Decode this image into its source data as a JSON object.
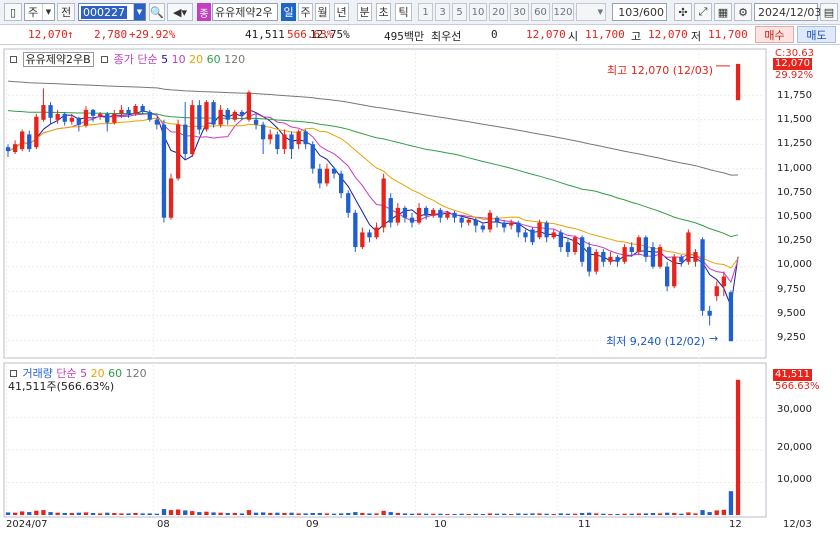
{
  "toolbar": {
    "market": "주",
    "scope": "전",
    "code": "000227",
    "name": "유유제약2우",
    "period_buttons": [
      "일",
      "주",
      "월",
      "년",
      "분",
      "초",
      "틱"
    ],
    "active_period": "일",
    "number_buttons": [
      "1",
      "3",
      "5",
      "10",
      "20",
      "30",
      "60",
      "120"
    ],
    "count": "103/600",
    "date": "2024/12/03"
  },
  "info": {
    "price": "12,070",
    "change": "2,780",
    "change_pct": "+29.92%",
    "volume": "41,511",
    "volume_pct": "566.63%",
    "turnover": "12.75%",
    "amount": "495백만",
    "priority_label": "최우선",
    "priority_value": "0",
    "close": "12,070",
    "open_label": "시",
    "open": "11,700",
    "high_label": "고",
    "high": "12,070",
    "low_label": "저",
    "low": "11,700",
    "buy_label": "매수",
    "sell_label": "매도"
  },
  "price_panel": {
    "name": "유유제약2우B",
    "legend_label": "종가 단순",
    "ma_periods": [
      "5",
      "10",
      "20",
      "60",
      "120"
    ],
    "max_note": "최고 12,070 (12/03)",
    "min_note": "최저 9,240 (12/02)",
    "tag_top": "C:30.63",
    "tag_price": "12,070",
    "tag_pct": "29.92%",
    "y_ticks": [
      "11,750",
      "11,500",
      "11,250",
      "11,000",
      "10,750",
      "10,500",
      "10,250",
      "10,000",
      "9,750",
      "9,500",
      "9,250"
    ]
  },
  "volume_panel": {
    "legend_label": "거래량",
    "ma_label": "단순",
    "ma_periods": [
      "5",
      "20",
      "60",
      "120"
    ],
    "current": "41,511주(566.63%)",
    "tag_value": "41,511",
    "tag_pct": "566.63%",
    "y_ticks": [
      "30,000",
      "20,000",
      "10,000"
    ]
  },
  "x_labels": [
    "2024/07",
    "08",
    "09",
    "10",
    "11",
    "12",
    "12/03"
  ],
  "colors": {
    "up": "#e8231b",
    "down": "#1f5fd0",
    "ma5": "#1a1aa0",
    "ma10": "#c23fc2",
    "ma20": "#e8a400",
    "ma60": "#2f9e4a",
    "ma120": "#777777"
  },
  "chart_data": {
    "type": "candlestick",
    "price_range": [
      9150,
      12120
    ],
    "volume_range": [
      0,
      43000
    ],
    "candles": [
      {
        "o": 11220,
        "c": 11180,
        "h": 11250,
        "l": 11120,
        "v": 800
      },
      {
        "o": 11170,
        "c": 11250,
        "h": 11290,
        "l": 11150,
        "v": 700
      },
      {
        "o": 11200,
        "c": 11380,
        "h": 11400,
        "l": 11180,
        "v": 1100
      },
      {
        "o": 11350,
        "c": 11200,
        "h": 11390,
        "l": 11170,
        "v": 900
      },
      {
        "o": 11220,
        "c": 11530,
        "h": 11560,
        "l": 11200,
        "v": 1300
      },
      {
        "o": 11500,
        "c": 11650,
        "h": 11820,
        "l": 11480,
        "v": 1500
      },
      {
        "o": 11650,
        "c": 11520,
        "h": 11680,
        "l": 11450,
        "v": 900
      },
      {
        "o": 11500,
        "c": 11560,
        "h": 11600,
        "l": 11460,
        "v": 700
      },
      {
        "o": 11560,
        "c": 11480,
        "h": 11580,
        "l": 11440,
        "v": 600
      },
      {
        "o": 11480,
        "c": 11520,
        "h": 11560,
        "l": 11450,
        "v": 600
      },
      {
        "o": 11520,
        "c": 11450,
        "h": 11530,
        "l": 11380,
        "v": 700
      },
      {
        "o": 11440,
        "c": 11600,
        "h": 11640,
        "l": 11420,
        "v": 800
      },
      {
        "o": 11600,
        "c": 11540,
        "h": 11610,
        "l": 11480,
        "v": 600
      },
      {
        "o": 11540,
        "c": 11560,
        "h": 11580,
        "l": 11500,
        "v": 500
      },
      {
        "o": 11560,
        "c": 11470,
        "h": 11580,
        "l": 11380,
        "v": 700
      },
      {
        "o": 11470,
        "c": 11560,
        "h": 11600,
        "l": 11450,
        "v": 600
      },
      {
        "o": 11560,
        "c": 11600,
        "h": 11650,
        "l": 11520,
        "v": 500
      },
      {
        "o": 11600,
        "c": 11560,
        "h": 11630,
        "l": 11520,
        "v": 500
      },
      {
        "o": 11560,
        "c": 11640,
        "h": 11660,
        "l": 11540,
        "v": 600
      },
      {
        "o": 11640,
        "c": 11580,
        "h": 11660,
        "l": 11560,
        "v": 500
      },
      {
        "o": 11580,
        "c": 11500,
        "h": 11600,
        "l": 11480,
        "v": 500
      },
      {
        "o": 11500,
        "c": 11450,
        "h": 11520,
        "l": 11400,
        "v": 400
      },
      {
        "o": 11450,
        "c": 10500,
        "h": 11500,
        "l": 10450,
        "v": 1800
      },
      {
        "o": 10500,
        "c": 10900,
        "h": 10950,
        "l": 10480,
        "v": 1500
      },
      {
        "o": 10900,
        "c": 11450,
        "h": 11500,
        "l": 10880,
        "v": 1700
      },
      {
        "o": 11450,
        "c": 11150,
        "h": 11680,
        "l": 11100,
        "v": 1400
      },
      {
        "o": 11150,
        "c": 11650,
        "h": 11700,
        "l": 11120,
        "v": 1200
      },
      {
        "o": 11650,
        "c": 11400,
        "h": 11700,
        "l": 11350,
        "v": 900
      },
      {
        "o": 11400,
        "c": 11680,
        "h": 11700,
        "l": 11380,
        "v": 1000
      },
      {
        "o": 11680,
        "c": 11450,
        "h": 11700,
        "l": 11420,
        "v": 800
      },
      {
        "o": 11450,
        "c": 11600,
        "h": 11650,
        "l": 11420,
        "v": 700
      },
      {
        "o": 11600,
        "c": 11500,
        "h": 11620,
        "l": 11450,
        "v": 600
      },
      {
        "o": 11500,
        "c": 11580,
        "h": 11600,
        "l": 11480,
        "v": 600
      },
      {
        "o": 11580,
        "c": 11550,
        "h": 11600,
        "l": 11500,
        "v": 500
      },
      {
        "o": 11500,
        "c": 11780,
        "h": 11800,
        "l": 11480,
        "v": 1500
      },
      {
        "o": 11500,
        "c": 11450,
        "h": 11560,
        "l": 11400,
        "v": 700
      },
      {
        "o": 11450,
        "c": 11300,
        "h": 11480,
        "l": 11150,
        "v": 800
      },
      {
        "o": 11300,
        "c": 11350,
        "h": 11400,
        "l": 11250,
        "v": 600
      },
      {
        "o": 11350,
        "c": 11200,
        "h": 11380,
        "l": 11150,
        "v": 700
      },
      {
        "o": 11200,
        "c": 11350,
        "h": 11400,
        "l": 11150,
        "v": 600
      },
      {
        "o": 11350,
        "c": 11200,
        "h": 11380,
        "l": 11100,
        "v": 700
      },
      {
        "o": 11250,
        "c": 11380,
        "h": 11400,
        "l": 11200,
        "v": 500
      },
      {
        "o": 11380,
        "c": 11250,
        "h": 11400,
        "l": 11200,
        "v": 500
      },
      {
        "o": 11250,
        "c": 11000,
        "h": 11280,
        "l": 10950,
        "v": 600
      },
      {
        "o": 11000,
        "c": 10850,
        "h": 11050,
        "l": 10800,
        "v": 600
      },
      {
        "o": 10850,
        "c": 11000,
        "h": 11050,
        "l": 10820,
        "v": 500
      },
      {
        "o": 11000,
        "c": 10950,
        "h": 11020,
        "l": 10900,
        "v": 400
      },
      {
        "o": 10950,
        "c": 10750,
        "h": 10980,
        "l": 10700,
        "v": 500
      },
      {
        "o": 10750,
        "c": 10550,
        "h": 10780,
        "l": 10500,
        "v": 600
      },
      {
        "o": 10550,
        "c": 10200,
        "h": 10580,
        "l": 10150,
        "v": 900
      },
      {
        "o": 10200,
        "c": 10350,
        "h": 10400,
        "l": 10180,
        "v": 600
      },
      {
        "o": 10350,
        "c": 10300,
        "h": 10380,
        "l": 10250,
        "v": 500
      },
      {
        "o": 10300,
        "c": 10400,
        "h": 10450,
        "l": 10280,
        "v": 500
      },
      {
        "o": 10400,
        "c": 10900,
        "h": 10950,
        "l": 10350,
        "v": 1300
      },
      {
        "o": 10700,
        "c": 10450,
        "h": 10750,
        "l": 10400,
        "v": 900
      },
      {
        "o": 10450,
        "c": 10600,
        "h": 10650,
        "l": 10420,
        "v": 600
      },
      {
        "o": 10600,
        "c": 10500,
        "h": 10620,
        "l": 10450,
        "v": 500
      },
      {
        "o": 10500,
        "c": 10450,
        "h": 10550,
        "l": 10400,
        "v": 400
      },
      {
        "o": 10450,
        "c": 10600,
        "h": 10650,
        "l": 10430,
        "v": 500
      },
      {
        "o": 10600,
        "c": 10520,
        "h": 10620,
        "l": 10480,
        "v": 400
      },
      {
        "o": 10520,
        "c": 10580,
        "h": 10600,
        "l": 10500,
        "v": 400
      },
      {
        "o": 10580,
        "c": 10500,
        "h": 10600,
        "l": 10450,
        "v": 400
      },
      {
        "o": 10500,
        "c": 10550,
        "h": 10570,
        "l": 10480,
        "v": 300
      },
      {
        "o": 10550,
        "c": 10500,
        "h": 10570,
        "l": 10450,
        "v": 300
      },
      {
        "o": 10500,
        "c": 10450,
        "h": 10520,
        "l": 10400,
        "v": 400
      },
      {
        "o": 10450,
        "c": 10480,
        "h": 10500,
        "l": 10420,
        "v": 300
      },
      {
        "o": 10480,
        "c": 10420,
        "h": 10500,
        "l": 10350,
        "v": 400
      },
      {
        "o": 10420,
        "c": 10380,
        "h": 10450,
        "l": 10350,
        "v": 300
      },
      {
        "o": 10380,
        "c": 10550,
        "h": 10580,
        "l": 10350,
        "v": 500
      },
      {
        "o": 10500,
        "c": 10450,
        "h": 10520,
        "l": 10400,
        "v": 400
      },
      {
        "o": 10450,
        "c": 10400,
        "h": 10480,
        "l": 10350,
        "v": 400
      },
      {
        "o": 10420,
        "c": 10450,
        "h": 10480,
        "l": 10380,
        "v": 300
      },
      {
        "o": 10450,
        "c": 10350,
        "h": 10470,
        "l": 10300,
        "v": 500
      },
      {
        "o": 10350,
        "c": 10300,
        "h": 10380,
        "l": 10250,
        "v": 400
      },
      {
        "o": 10380,
        "c": 10250,
        "h": 10400,
        "l": 10220,
        "v": 500
      },
      {
        "o": 10300,
        "c": 10450,
        "h": 10480,
        "l": 10280,
        "v": 500
      },
      {
        "o": 10450,
        "c": 10300,
        "h": 10470,
        "l": 10250,
        "v": 400
      },
      {
        "o": 10300,
        "c": 10350,
        "h": 10380,
        "l": 10280,
        "v": 300
      },
      {
        "o": 10350,
        "c": 10200,
        "h": 10380,
        "l": 10150,
        "v": 500
      },
      {
        "o": 10250,
        "c": 10150,
        "h": 10280,
        "l": 10100,
        "v": 400
      },
      {
        "o": 10150,
        "c": 10300,
        "h": 10320,
        "l": 10120,
        "v": 400
      },
      {
        "o": 10300,
        "c": 10050,
        "h": 10320,
        "l": 10000,
        "v": 600
      },
      {
        "o": 10200,
        "c": 9950,
        "h": 10250,
        "l": 9900,
        "v": 700
      },
      {
        "o": 9950,
        "c": 10150,
        "h": 10180,
        "l": 9920,
        "v": 500
      },
      {
        "o": 10150,
        "c": 10050,
        "h": 10180,
        "l": 10000,
        "v": 400
      },
      {
        "o": 10050,
        "c": 10100,
        "h": 10150,
        "l": 10020,
        "v": 300
      },
      {
        "o": 10100,
        "c": 10050,
        "h": 10120,
        "l": 10000,
        "v": 300
      },
      {
        "o": 10050,
        "c": 10200,
        "h": 10230,
        "l": 10030,
        "v": 400
      },
      {
        "o": 10200,
        "c": 10150,
        "h": 10250,
        "l": 10100,
        "v": 400
      },
      {
        "o": 10150,
        "c": 10300,
        "h": 10320,
        "l": 10120,
        "v": 500
      },
      {
        "o": 10300,
        "c": 10100,
        "h": 10320,
        "l": 10050,
        "v": 500
      },
      {
        "o": 10200,
        "c": 10000,
        "h": 10250,
        "l": 9980,
        "v": 600
      },
      {
        "o": 10000,
        "c": 10200,
        "h": 10230,
        "l": 9980,
        "v": 500
      },
      {
        "o": 10000,
        "c": 9800,
        "h": 10050,
        "l": 9750,
        "v": 700
      },
      {
        "o": 9800,
        "c": 10100,
        "h": 10130,
        "l": 9780,
        "v": 600
      },
      {
        "o": 10100,
        "c": 10050,
        "h": 10120,
        "l": 10000,
        "v": 400
      },
      {
        "o": 10050,
        "c": 10350,
        "h": 10380,
        "l": 10020,
        "v": 800
      },
      {
        "o": 10050,
        "c": 10150,
        "h": 10180,
        "l": 10000,
        "v": 500
      },
      {
        "o": 10280,
        "c": 9550,
        "h": 10300,
        "l": 9500,
        "v": 1500
      },
      {
        "o": 9550,
        "c": 9500,
        "h": 9600,
        "l": 9400,
        "v": 900
      },
      {
        "o": 9700,
        "c": 9800,
        "h": 9850,
        "l": 9650,
        "v": 1400
      },
      {
        "o": 9800,
        "c": 9900,
        "h": 9950,
        "l": 9700,
        "v": 1600
      },
      {
        "o": 9740,
        "c": 9240,
        "h": 9760,
        "l": 9240,
        "v": 7300
      },
      {
        "o": 11700,
        "c": 12070,
        "h": 12070,
        "l": 11700,
        "v": 41511
      }
    ],
    "ma_series": [
      {
        "name": "5",
        "color_key": "ma5"
      },
      {
        "name": "10",
        "color_key": "ma10"
      },
      {
        "name": "20",
        "color_key": "ma20"
      },
      {
        "name": "60",
        "color_key": "ma60"
      },
      {
        "name": "120",
        "color_key": "ma120"
      }
    ]
  }
}
